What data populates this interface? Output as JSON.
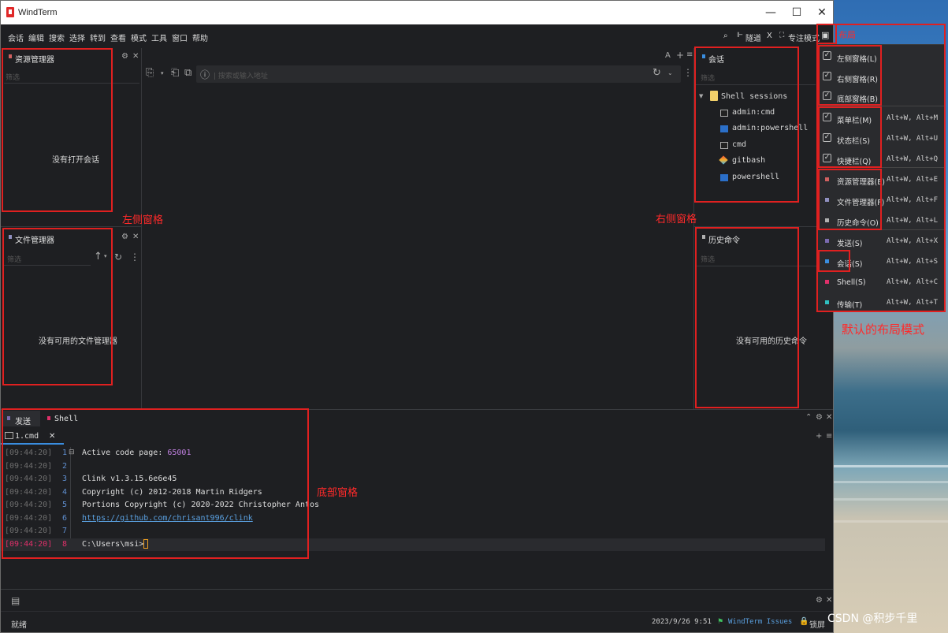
{
  "window": {
    "title": "WindTerm"
  },
  "menubar": {
    "items": [
      "会话",
      "编辑",
      "搜索",
      "选择",
      "转到",
      "查看",
      "模式",
      "工具",
      "窗口",
      "帮助"
    ],
    "right": {
      "tunnel": "隧道",
      "x": "X",
      "focus": "专注模式"
    }
  },
  "left_panels": {
    "explorer": {
      "title": "资源管理器",
      "filter": "筛选",
      "empty": "没有打开会话"
    },
    "file_manager": {
      "title": "文件管理器",
      "filter": "筛选",
      "empty": "没有可用的文件管理器"
    }
  },
  "center": {
    "address_placeholder": "| 搜索或输入地址",
    "font_btn": "A",
    "add_btn": "+",
    "menu_btn": "≡"
  },
  "right_panels": {
    "sessions": {
      "title": "会话",
      "filter": "筛选",
      "group": "Shell sessions",
      "items": [
        "admin:cmd",
        "admin:powershell",
        "cmd",
        "gitbash",
        "powershell"
      ]
    },
    "history": {
      "title": "历史命令",
      "filter": "筛选",
      "empty": "没有可用的历史命令"
    }
  },
  "bottom": {
    "tabs": [
      "发送",
      "Shell"
    ],
    "session_tab": "1.cmd",
    "lines": [
      {
        "ts": "[09:44:20]",
        "n": "1",
        "text": "Active code page: ",
        "extra": "65001"
      },
      {
        "ts": "[09:44:20]",
        "n": "2",
        "text": ""
      },
      {
        "ts": "[09:44:20]",
        "n": "3",
        "text": "Clink v1.3.15.6e6e45"
      },
      {
        "ts": "[09:44:20]",
        "n": "4",
        "text": "Copyright (c) 2012-2018 Martin Ridgers"
      },
      {
        "ts": "[09:44:20]",
        "n": "5",
        "text": "Portions Copyright (c) 2020-2022 Christopher Antos"
      },
      {
        "ts": "[09:44:20]",
        "n": "6",
        "text": "https://github.com/chrisant996/clink"
      },
      {
        "ts": "[09:44:20]",
        "n": "7",
        "text": ""
      },
      {
        "ts": "[09:44:20]",
        "n": "8",
        "text": "C:\\Users\\msi>"
      }
    ]
  },
  "statusbar": {
    "ready": "就绪",
    "datetime": "2023/9/26 9:51",
    "issues": "WindTerm Issues",
    "lock": "锁屏"
  },
  "layout_menu": {
    "title": "布局",
    "items": [
      {
        "label": "左侧窗格(L)",
        "shortcut": "",
        "type": "check"
      },
      {
        "label": "右侧窗格(R)",
        "shortcut": "",
        "type": "check"
      },
      {
        "label": "底部窗格(B)",
        "shortcut": "",
        "type": "check"
      },
      {
        "label": "菜单栏(M)",
        "shortcut": "Alt+W, Alt+M",
        "type": "check"
      },
      {
        "label": "状态栏(S)",
        "shortcut": "Alt+W, Alt+U",
        "type": "check"
      },
      {
        "label": "快捷栏(Q)",
        "shortcut": "Alt+W, Alt+Q",
        "type": "check"
      },
      {
        "label": "资源管理器(E)",
        "shortcut": "Alt+W, Alt+E",
        "type": "dot",
        "color": "#d06060"
      },
      {
        "label": "文件管理器(F)",
        "shortcut": "Alt+W, Alt+F",
        "type": "dot",
        "color": "#9090c0"
      },
      {
        "label": "历史命令(O)",
        "shortcut": "Alt+W, Alt+L",
        "type": "dot",
        "color": "#b0b0b0"
      },
      {
        "label": "发送(S)",
        "shortcut": "Alt+W, Alt+X",
        "type": "dot",
        "color": "#7a6ab0"
      },
      {
        "label": "会话(S)",
        "shortcut": "Alt+W, Alt+S",
        "type": "dot",
        "color": "#3a8ee0"
      },
      {
        "label": "Shell(S)",
        "shortcut": "Alt+W, Alt+C",
        "type": "dot",
        "color": "#e0306a"
      },
      {
        "label": "传输(T)",
        "shortcut": "Alt+W, Alt+T",
        "type": "dot",
        "color": "#30c0c0"
      }
    ]
  },
  "annotations": {
    "left": "左侧窗格",
    "right": "右侧窗格",
    "bottom": "底部窗格",
    "default_layout": "默认的布局模式"
  },
  "watermark": "CSDN @积步千里",
  "colors": {
    "annotation": "#e02020",
    "link": "#5aa0e0",
    "number": "#c080e0"
  }
}
